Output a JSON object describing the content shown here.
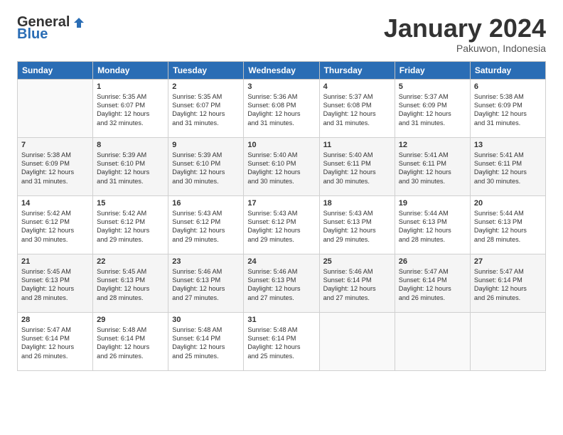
{
  "header": {
    "logo_general": "General",
    "logo_blue": "Blue",
    "month_title": "January 2024",
    "subtitle": "Pakuwon, Indonesia"
  },
  "weekdays": [
    "Sunday",
    "Monday",
    "Tuesday",
    "Wednesday",
    "Thursday",
    "Friday",
    "Saturday"
  ],
  "weeks": [
    [
      {
        "day": "",
        "text": ""
      },
      {
        "day": "1",
        "text": "Sunrise: 5:35 AM\nSunset: 6:07 PM\nDaylight: 12 hours\nand 32 minutes."
      },
      {
        "day": "2",
        "text": "Sunrise: 5:35 AM\nSunset: 6:07 PM\nDaylight: 12 hours\nand 31 minutes."
      },
      {
        "day": "3",
        "text": "Sunrise: 5:36 AM\nSunset: 6:08 PM\nDaylight: 12 hours\nand 31 minutes."
      },
      {
        "day": "4",
        "text": "Sunrise: 5:37 AM\nSunset: 6:08 PM\nDaylight: 12 hours\nand 31 minutes."
      },
      {
        "day": "5",
        "text": "Sunrise: 5:37 AM\nSunset: 6:09 PM\nDaylight: 12 hours\nand 31 minutes."
      },
      {
        "day": "6",
        "text": "Sunrise: 5:38 AM\nSunset: 6:09 PM\nDaylight: 12 hours\nand 31 minutes."
      }
    ],
    [
      {
        "day": "7",
        "text": "Sunrise: 5:38 AM\nSunset: 6:09 PM\nDaylight: 12 hours\nand 31 minutes."
      },
      {
        "day": "8",
        "text": "Sunrise: 5:39 AM\nSunset: 6:10 PM\nDaylight: 12 hours\nand 31 minutes."
      },
      {
        "day": "9",
        "text": "Sunrise: 5:39 AM\nSunset: 6:10 PM\nDaylight: 12 hours\nand 30 minutes."
      },
      {
        "day": "10",
        "text": "Sunrise: 5:40 AM\nSunset: 6:10 PM\nDaylight: 12 hours\nand 30 minutes."
      },
      {
        "day": "11",
        "text": "Sunrise: 5:40 AM\nSunset: 6:11 PM\nDaylight: 12 hours\nand 30 minutes."
      },
      {
        "day": "12",
        "text": "Sunrise: 5:41 AM\nSunset: 6:11 PM\nDaylight: 12 hours\nand 30 minutes."
      },
      {
        "day": "13",
        "text": "Sunrise: 5:41 AM\nSunset: 6:11 PM\nDaylight: 12 hours\nand 30 minutes."
      }
    ],
    [
      {
        "day": "14",
        "text": "Sunrise: 5:42 AM\nSunset: 6:12 PM\nDaylight: 12 hours\nand 30 minutes."
      },
      {
        "day": "15",
        "text": "Sunrise: 5:42 AM\nSunset: 6:12 PM\nDaylight: 12 hours\nand 29 minutes."
      },
      {
        "day": "16",
        "text": "Sunrise: 5:43 AM\nSunset: 6:12 PM\nDaylight: 12 hours\nand 29 minutes."
      },
      {
        "day": "17",
        "text": "Sunrise: 5:43 AM\nSunset: 6:12 PM\nDaylight: 12 hours\nand 29 minutes."
      },
      {
        "day": "18",
        "text": "Sunrise: 5:43 AM\nSunset: 6:13 PM\nDaylight: 12 hours\nand 29 minutes."
      },
      {
        "day": "19",
        "text": "Sunrise: 5:44 AM\nSunset: 6:13 PM\nDaylight: 12 hours\nand 28 minutes."
      },
      {
        "day": "20",
        "text": "Sunrise: 5:44 AM\nSunset: 6:13 PM\nDaylight: 12 hours\nand 28 minutes."
      }
    ],
    [
      {
        "day": "21",
        "text": "Sunrise: 5:45 AM\nSunset: 6:13 PM\nDaylight: 12 hours\nand 28 minutes."
      },
      {
        "day": "22",
        "text": "Sunrise: 5:45 AM\nSunset: 6:13 PM\nDaylight: 12 hours\nand 28 minutes."
      },
      {
        "day": "23",
        "text": "Sunrise: 5:46 AM\nSunset: 6:13 PM\nDaylight: 12 hours\nand 27 minutes."
      },
      {
        "day": "24",
        "text": "Sunrise: 5:46 AM\nSunset: 6:13 PM\nDaylight: 12 hours\nand 27 minutes."
      },
      {
        "day": "25",
        "text": "Sunrise: 5:46 AM\nSunset: 6:14 PM\nDaylight: 12 hours\nand 27 minutes."
      },
      {
        "day": "26",
        "text": "Sunrise: 5:47 AM\nSunset: 6:14 PM\nDaylight: 12 hours\nand 26 minutes."
      },
      {
        "day": "27",
        "text": "Sunrise: 5:47 AM\nSunset: 6:14 PM\nDaylight: 12 hours\nand 26 minutes."
      }
    ],
    [
      {
        "day": "28",
        "text": "Sunrise: 5:47 AM\nSunset: 6:14 PM\nDaylight: 12 hours\nand 26 minutes."
      },
      {
        "day": "29",
        "text": "Sunrise: 5:48 AM\nSunset: 6:14 PM\nDaylight: 12 hours\nand 26 minutes."
      },
      {
        "day": "30",
        "text": "Sunrise: 5:48 AM\nSunset: 6:14 PM\nDaylight: 12 hours\nand 25 minutes."
      },
      {
        "day": "31",
        "text": "Sunrise: 5:48 AM\nSunset: 6:14 PM\nDaylight: 12 hours\nand 25 minutes."
      },
      {
        "day": "",
        "text": ""
      },
      {
        "day": "",
        "text": ""
      },
      {
        "day": "",
        "text": ""
      }
    ]
  ]
}
